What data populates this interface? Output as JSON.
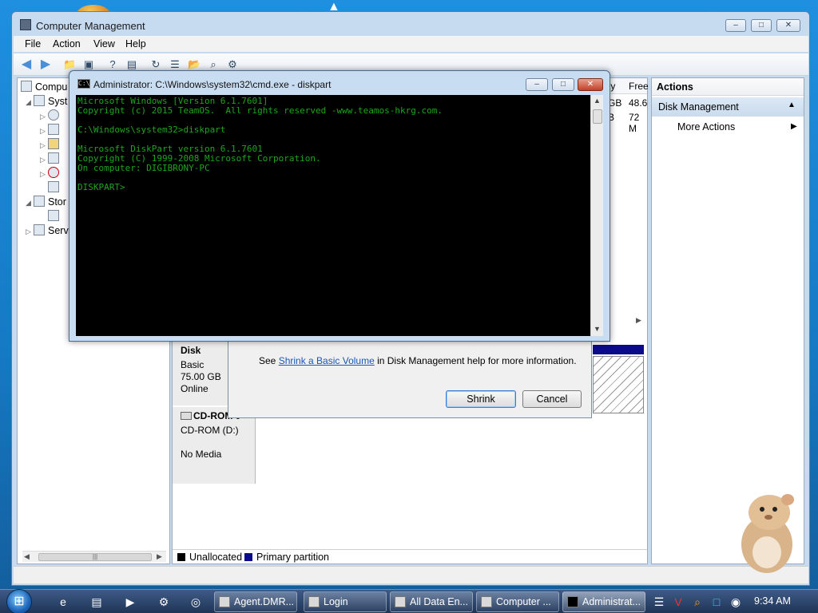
{
  "computer_management": {
    "title": "Computer Management",
    "menu": [
      "File",
      "Action",
      "View",
      "Help"
    ],
    "tree": {
      "root": "Compu",
      "system_tools": "Syst",
      "storage": "Stor",
      "services": "Serv"
    },
    "volume_columns": {
      "capacity_fragment": "ty",
      "free": "Free"
    },
    "volume_rows": [
      {
        "capacity_fragment": "GB",
        "free": "48.6"
      },
      {
        "capacity_fragment": "B",
        "free": "72 M"
      }
    ],
    "disk0": {
      "name_fragment": "Disk",
      "type": "Basic",
      "size": "75.00 GB",
      "status": "Online"
    },
    "cdrom0": {
      "name": "CD-ROM 0",
      "type": "CD-ROM (D:)",
      "media": "No Media"
    },
    "legend": [
      {
        "label": "Unallocated",
        "color": "#000000"
      },
      {
        "label": "Primary partition",
        "color": "#0a0a8a"
      }
    ],
    "actions": {
      "header": "Actions",
      "section": "Disk Management",
      "more": "More Actions"
    }
  },
  "shrink_dialog": {
    "help_prefix": "See ",
    "help_link": "Shrink a Basic Volume",
    "help_suffix": " in Disk Management help for more information.",
    "shrink_label": "Shrink",
    "cancel_label": "Cancel"
  },
  "cmd": {
    "icon_text": "C:\\",
    "title": "Administrator: C:\\Windows\\system32\\cmd.exe - diskpart",
    "lines": "Microsoft Windows [Version 6.1.7601]\nCopyright (c) 2015 TeamOS.  All rights reserved -www.teamos-hkrg.com.\n\nC:\\Windows\\system32>diskpart\n\nMicrosoft DiskPart version 6.1.7601\nCopyright (C) 1999-2008 Microsoft Corporation.\nOn computer: DIGIBRONY-PC\n\nDISKPART>"
  },
  "taskbar": {
    "tasks": [
      "Agent.DMR...",
      "Login",
      "All Data En...",
      "Computer ...",
      "Administrat..."
    ],
    "clock": "9:34 AM"
  },
  "colors": {
    "cmd_text": "#1ea51e",
    "cmd_background": "#000000",
    "link": "#1a56b6"
  }
}
